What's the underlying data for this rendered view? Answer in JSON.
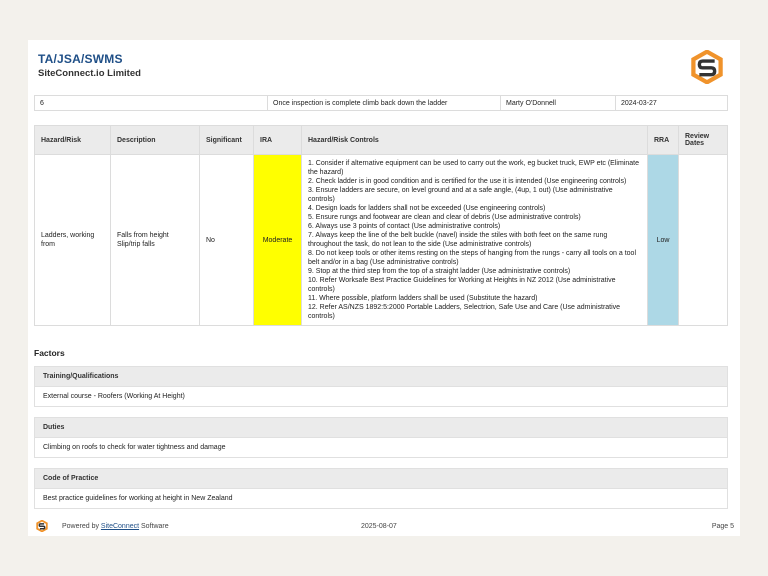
{
  "header": {
    "doc_title": "TA/JSA/SWMS",
    "company": "SiteConnect.io Limited"
  },
  "colors": {
    "brand_blue": "#1f4f87",
    "logo_orange": "#f0932b",
    "ira_moderate": "#ffff00",
    "rra_low": "#add8e6"
  },
  "step_row": {
    "number": "6",
    "description": "Once inspection is complete climb back down the ladder",
    "person": "Marty O'Donnell",
    "date": "2024-03-27"
  },
  "hazard_table": {
    "headers": {
      "hazard": "Hazard/Risk",
      "description": "Description",
      "significant": "Significant",
      "ira": "IRA",
      "controls": "Hazard/Risk Controls",
      "rra": "RRA",
      "review": "Review Dates"
    },
    "row": {
      "hazard": "Ladders, working from",
      "description": "Falls from height Slip/trip falls",
      "significant": "No",
      "ira": "Moderate",
      "rra": "Low",
      "review": "",
      "controls": [
        "1. Consider if alternative equipment can be used to carry out the work, eg bucket truck, EWP etc (Eliminate the hazard)",
        "2. Check ladder is in good condition and is certified for the use it is intended (Use engineering controls)",
        "3. Ensure ladders are secure, on level ground and at a safe angle, (4up, 1 out) (Use administrative controls)",
        "4. Design loads for ladders shall not be exceeded (Use engineering controls)",
        "5. Ensure rungs and footwear are clean and clear of debris (Use administrative controls)",
        "6. Always use 3 points of contact (Use administrative controls)",
        "7. Always keep the line of the belt buckle (navel) inside the stiles with both feet on the same rung throughout the task, do not lean to the side (Use administrative controls)",
        "8. Do not keep tools or other items resting on the steps of hanging from the rungs - carry all tools on a tool belt and/or in a bag (Use administrative controls)",
        "9. Stop at the third step from the top of a straight ladder (Use administrative controls)",
        "10. Refer Worksafe Best Practice Guidelines for Working at Heights in NZ 2012 (Use administrative controls)",
        "11. Where possible, platform ladders shall be used (Substitute the hazard)",
        "12. Refer AS/NZS 1892:5:2000 Portable Ladders, Selectrion, Safe Use and Care (Use administrative controls)"
      ]
    }
  },
  "factors": {
    "heading": "Factors",
    "items": [
      {
        "title": "Training/Qualifications",
        "value": "External course - Roofers (Working At Height)"
      },
      {
        "title": "Duties",
        "value": "Climbing on roofs to check for water tightness and damage"
      },
      {
        "title": "Code of Practice",
        "value": "Best practice guidelines for working at height in New Zealand"
      }
    ]
  },
  "footer": {
    "powered_prefix": "Powered by ",
    "powered_link": "SiteConnect",
    "powered_suffix": " Software",
    "date": "2025-08-07",
    "page": "Page 5"
  }
}
